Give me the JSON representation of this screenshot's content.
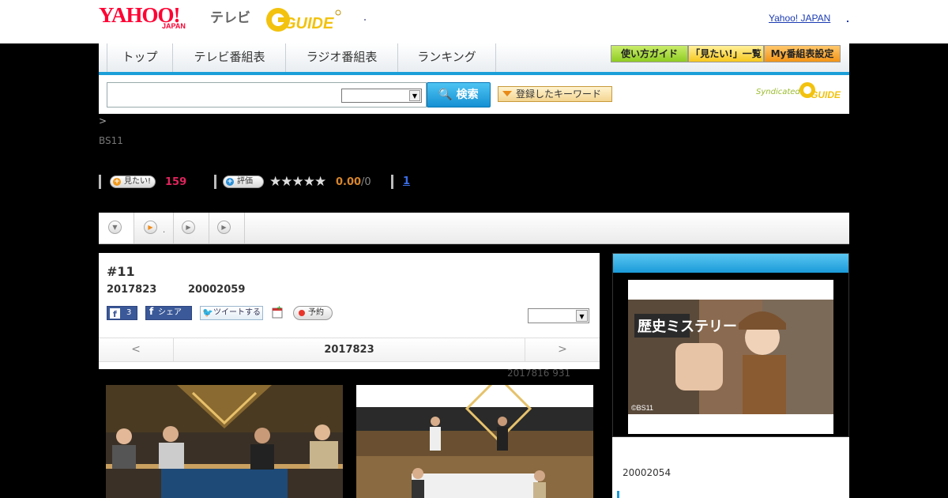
{
  "header": {
    "logo_yahoo": "YAHOO!",
    "logo_japan": "JAPAN",
    "logo_tv": "テレビ",
    "logo_gguide": "G-GUIDE",
    "yahoo_japan_link": "Yahoo! JAPAN"
  },
  "nav": {
    "tabs": [
      "トップ",
      "テレビ番組表",
      "ラジオ番組表",
      "ランキング"
    ],
    "guide_button": "使い方ガイド",
    "want_list_button": "「見たい!」一覧",
    "my_schedule_button": "My番組表設定"
  },
  "search": {
    "input_value": "",
    "select_value": "",
    "search_button": "検索",
    "keyword_button": "登録したキーワード",
    "syndicated_label": "Syndicated"
  },
  "program": {
    "breadcrumb": ">",
    "channel": "BS11",
    "want_label": "見たい!",
    "want_count": "159",
    "rate_label": "評価",
    "stars": "★★★★★",
    "rating": "0.00",
    "rating_count": "/0",
    "review_link": "1"
  },
  "tabs_bar": {
    "tab2_text": "."
  },
  "episode": {
    "title": "#11",
    "date": "2017823",
    "time": "20002059",
    "fb_count": "3",
    "fb_share_label": "シェア",
    "tweet_label": "ツイートする",
    "reserve_label": "予約",
    "select_value": "",
    "prev": "<",
    "current_date": "2017823",
    "next": ">",
    "updated": "2017816  931"
  },
  "side": {
    "poster_title": "歴史ミステリー",
    "poster_credit": "©BS11",
    "number": "20002054"
  }
}
